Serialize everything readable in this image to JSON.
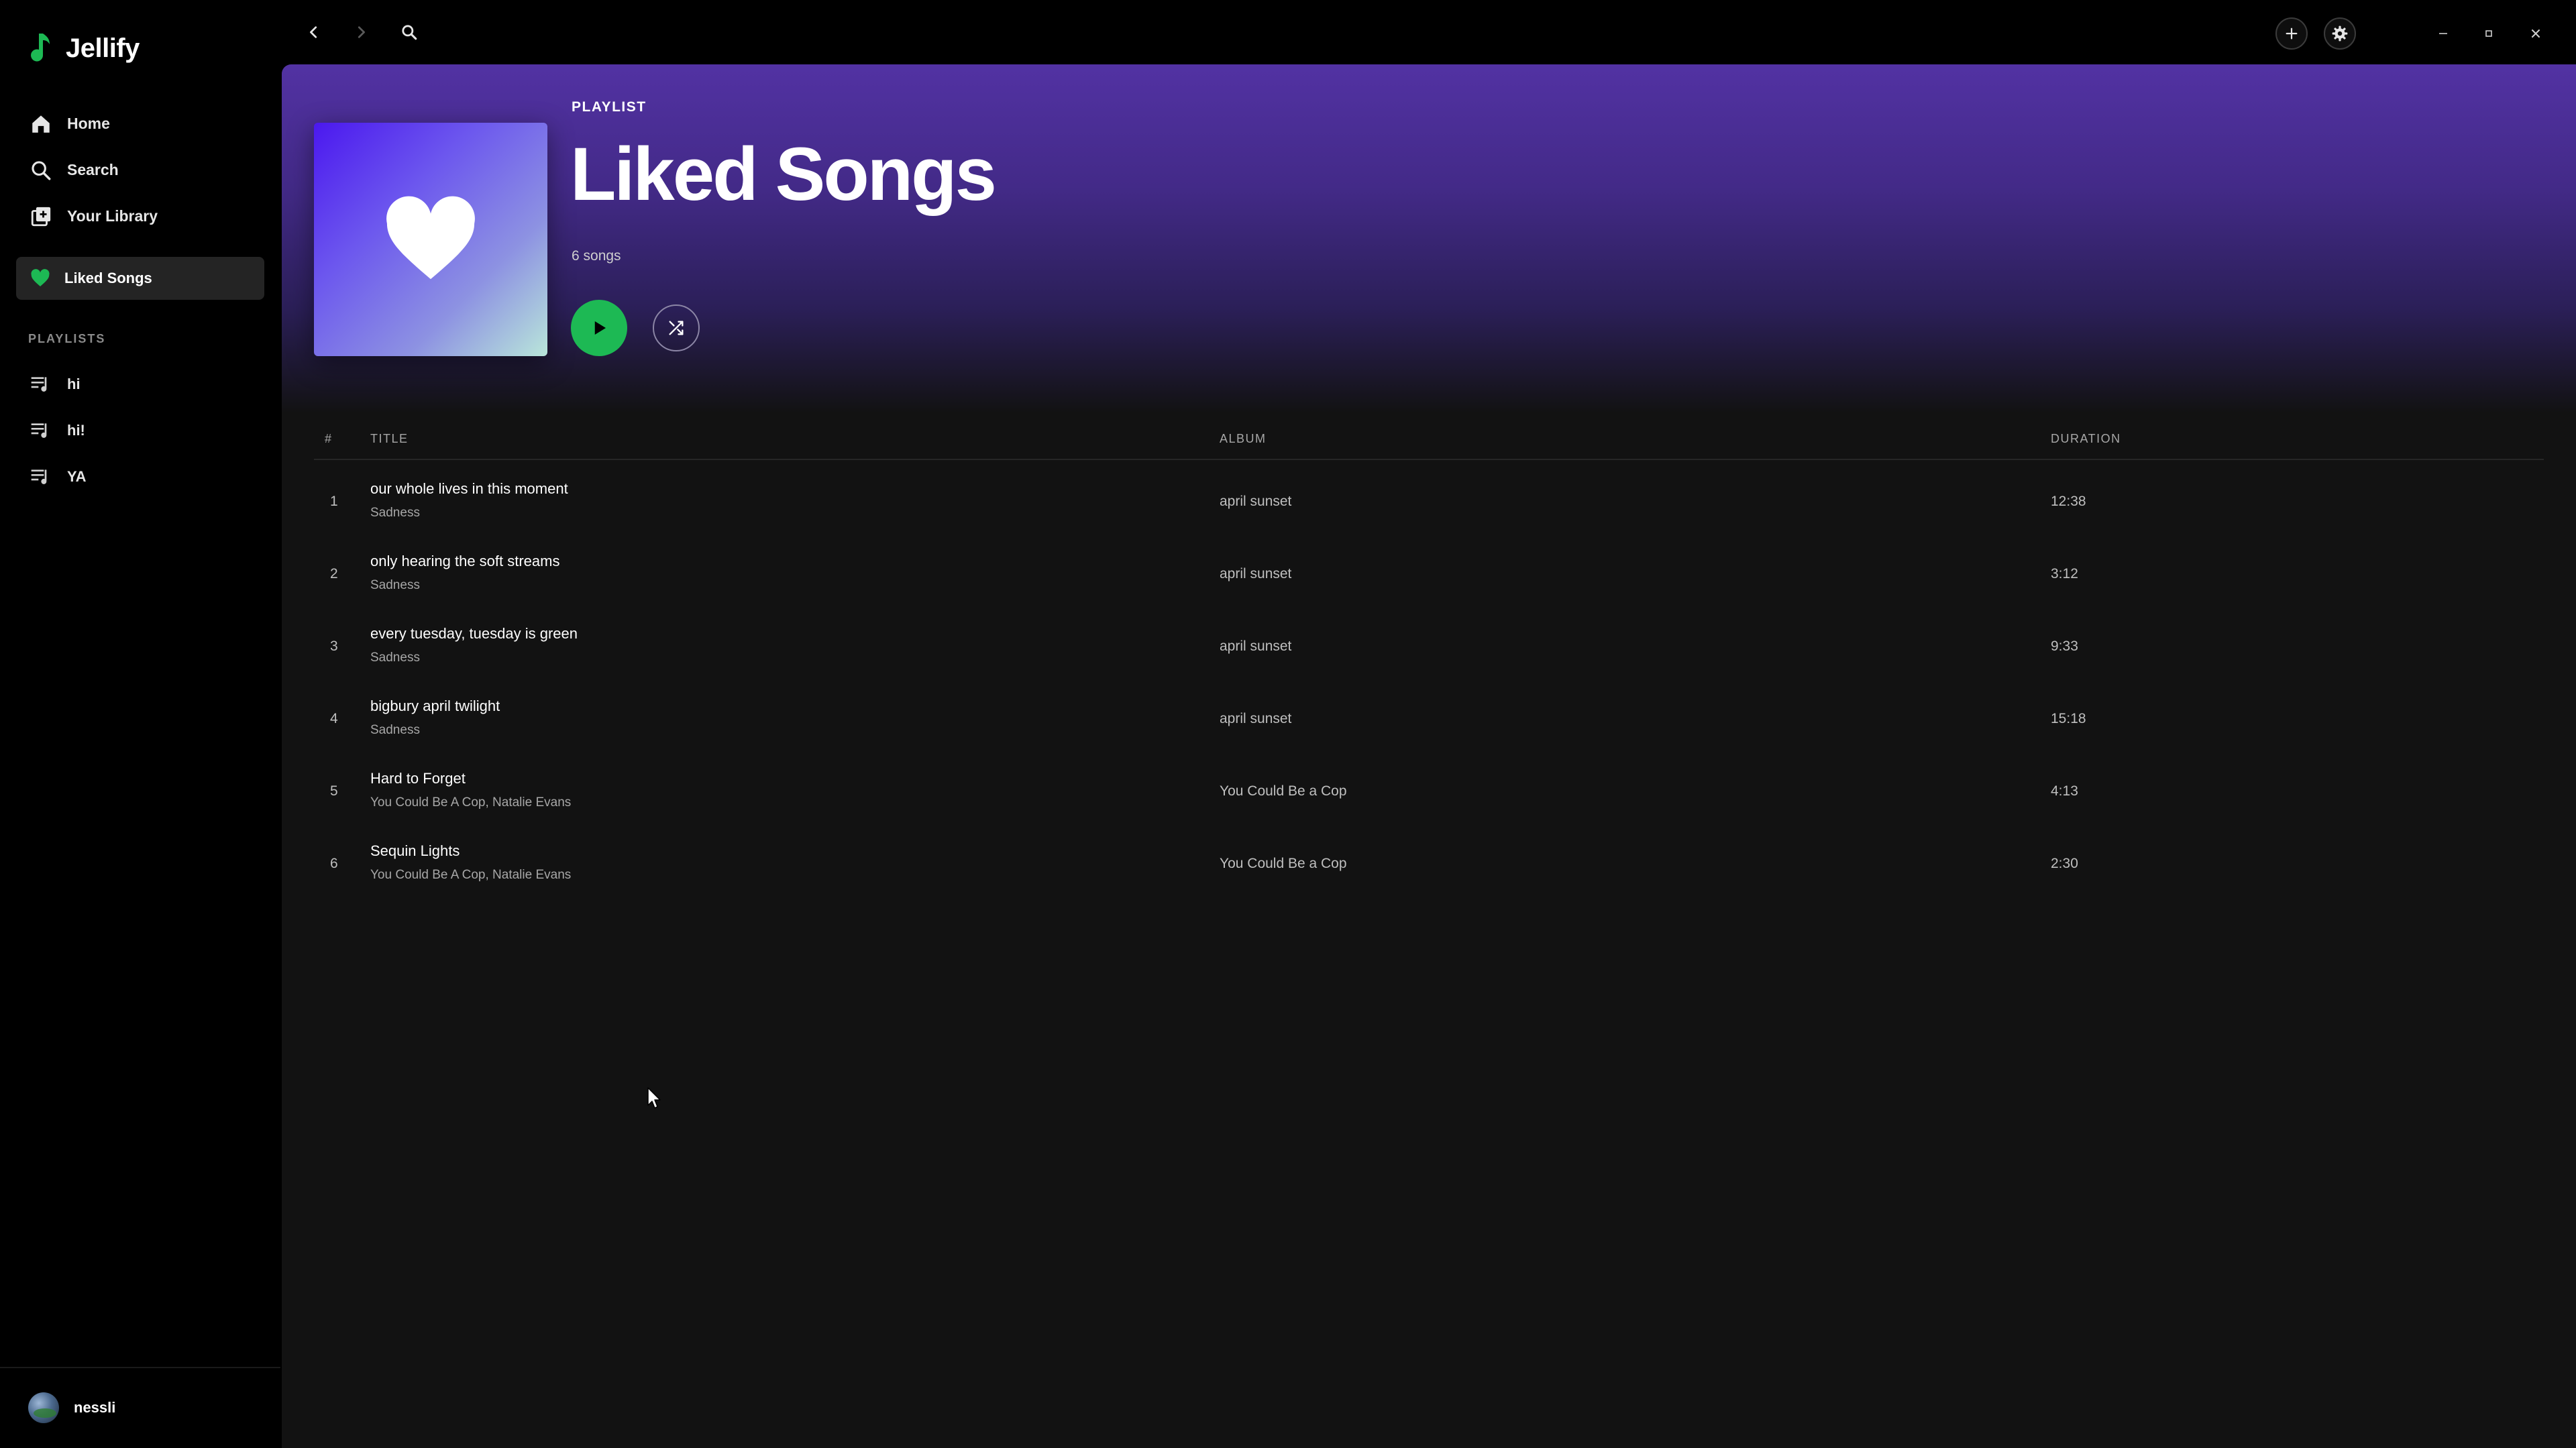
{
  "app": {
    "name": "Jellify",
    "accent": "#1db954"
  },
  "sidebar": {
    "nav": [
      {
        "label": "Home",
        "icon": "home-icon"
      },
      {
        "label": "Search",
        "icon": "search-icon"
      },
      {
        "label": "Your Library",
        "icon": "library-icon"
      }
    ],
    "liked": {
      "label": "Liked Songs",
      "icon": "heart-icon"
    },
    "playlists_label": "PLAYLISTS",
    "playlists": [
      {
        "label": "hi",
        "icon": "playlist-icon"
      },
      {
        "label": "hi!",
        "icon": "playlist-icon"
      },
      {
        "label": "YA",
        "icon": "playlist-icon"
      }
    ],
    "user": {
      "name": "nessli"
    }
  },
  "topbar": {
    "icons": [
      "back-icon",
      "forward-icon",
      "search-icon",
      "plus-icon",
      "gear-icon",
      "avatar",
      "minimize-icon",
      "maximize-icon",
      "close-icon"
    ]
  },
  "hero": {
    "eyebrow": "PLAYLIST",
    "title": "Liked Songs",
    "count": "6 songs",
    "gradient_top": "#5232a3"
  },
  "table": {
    "headers": {
      "num": "#",
      "title": "TITLE",
      "album": "ALBUM",
      "duration": "DURATION"
    },
    "rows": [
      {
        "num": "1",
        "title": "our whole lives in this moment",
        "artist": "Sadness",
        "album": "april sunset",
        "duration": "12:38"
      },
      {
        "num": "2",
        "title": "only hearing the soft streams",
        "artist": "Sadness",
        "album": "april sunset",
        "duration": "3:12"
      },
      {
        "num": "3",
        "title": "every tuesday, tuesday is green",
        "artist": "Sadness",
        "album": "april sunset",
        "duration": "9:33"
      },
      {
        "num": "4",
        "title": "bigbury april twilight",
        "artist": "Sadness",
        "album": "april sunset",
        "duration": "15:18"
      },
      {
        "num": "5",
        "title": "Hard to Forget",
        "artist": "You Could Be A Cop, Natalie Evans",
        "album": "You Could Be a Cop",
        "duration": "4:13"
      },
      {
        "num": "6",
        "title": "Sequin Lights",
        "artist": "You Could Be A Cop, Natalie Evans",
        "album": "You Could Be a Cop",
        "duration": "2:30"
      }
    ]
  }
}
